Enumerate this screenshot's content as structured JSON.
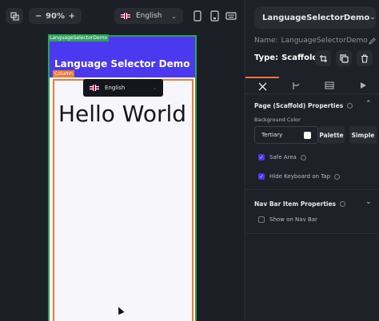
{
  "toolbar": {
    "zoom_minus": "−",
    "zoom_level": "90%",
    "zoom_plus": "+",
    "language": "English",
    "language_flag_icon": "uk-flag-icon"
  },
  "canvas": {
    "page_tag": "LanguageSelectorDemo",
    "column_tag": "Column",
    "appbar_title": "Language Selector Demo",
    "language_dropdown": "English",
    "hello_text": "Hello World"
  },
  "panel": {
    "widget_name": "LanguageSelectorDemo",
    "name_label": "Name:",
    "name_value": "LanguageSelectorDemo",
    "type_label": "Type:",
    "type_value": "Scaffold",
    "properties_title": "Page (Scaffold) Properties",
    "background_color_label": "Background Color",
    "background_color_value": "Tertiary",
    "palette_button": "Palette",
    "simple_button": "Simple",
    "safe_area_label": "Safe Area",
    "safe_area_checked": true,
    "hide_keyboard_label": "Hide Keyboard on Tap",
    "hide_keyboard_checked": true,
    "nav_bar_title": "Nav Bar Item Properties",
    "show_on_nav_bar_label": "Show on Nav Bar",
    "show_on_nav_bar_checked": false
  },
  "colors": {
    "appbar": "#4b39ef",
    "page_outline": "#2ea25a",
    "column_outline": "#e67c3a",
    "active_tab": "#e8744c",
    "panel_bg": "#1f2128"
  }
}
